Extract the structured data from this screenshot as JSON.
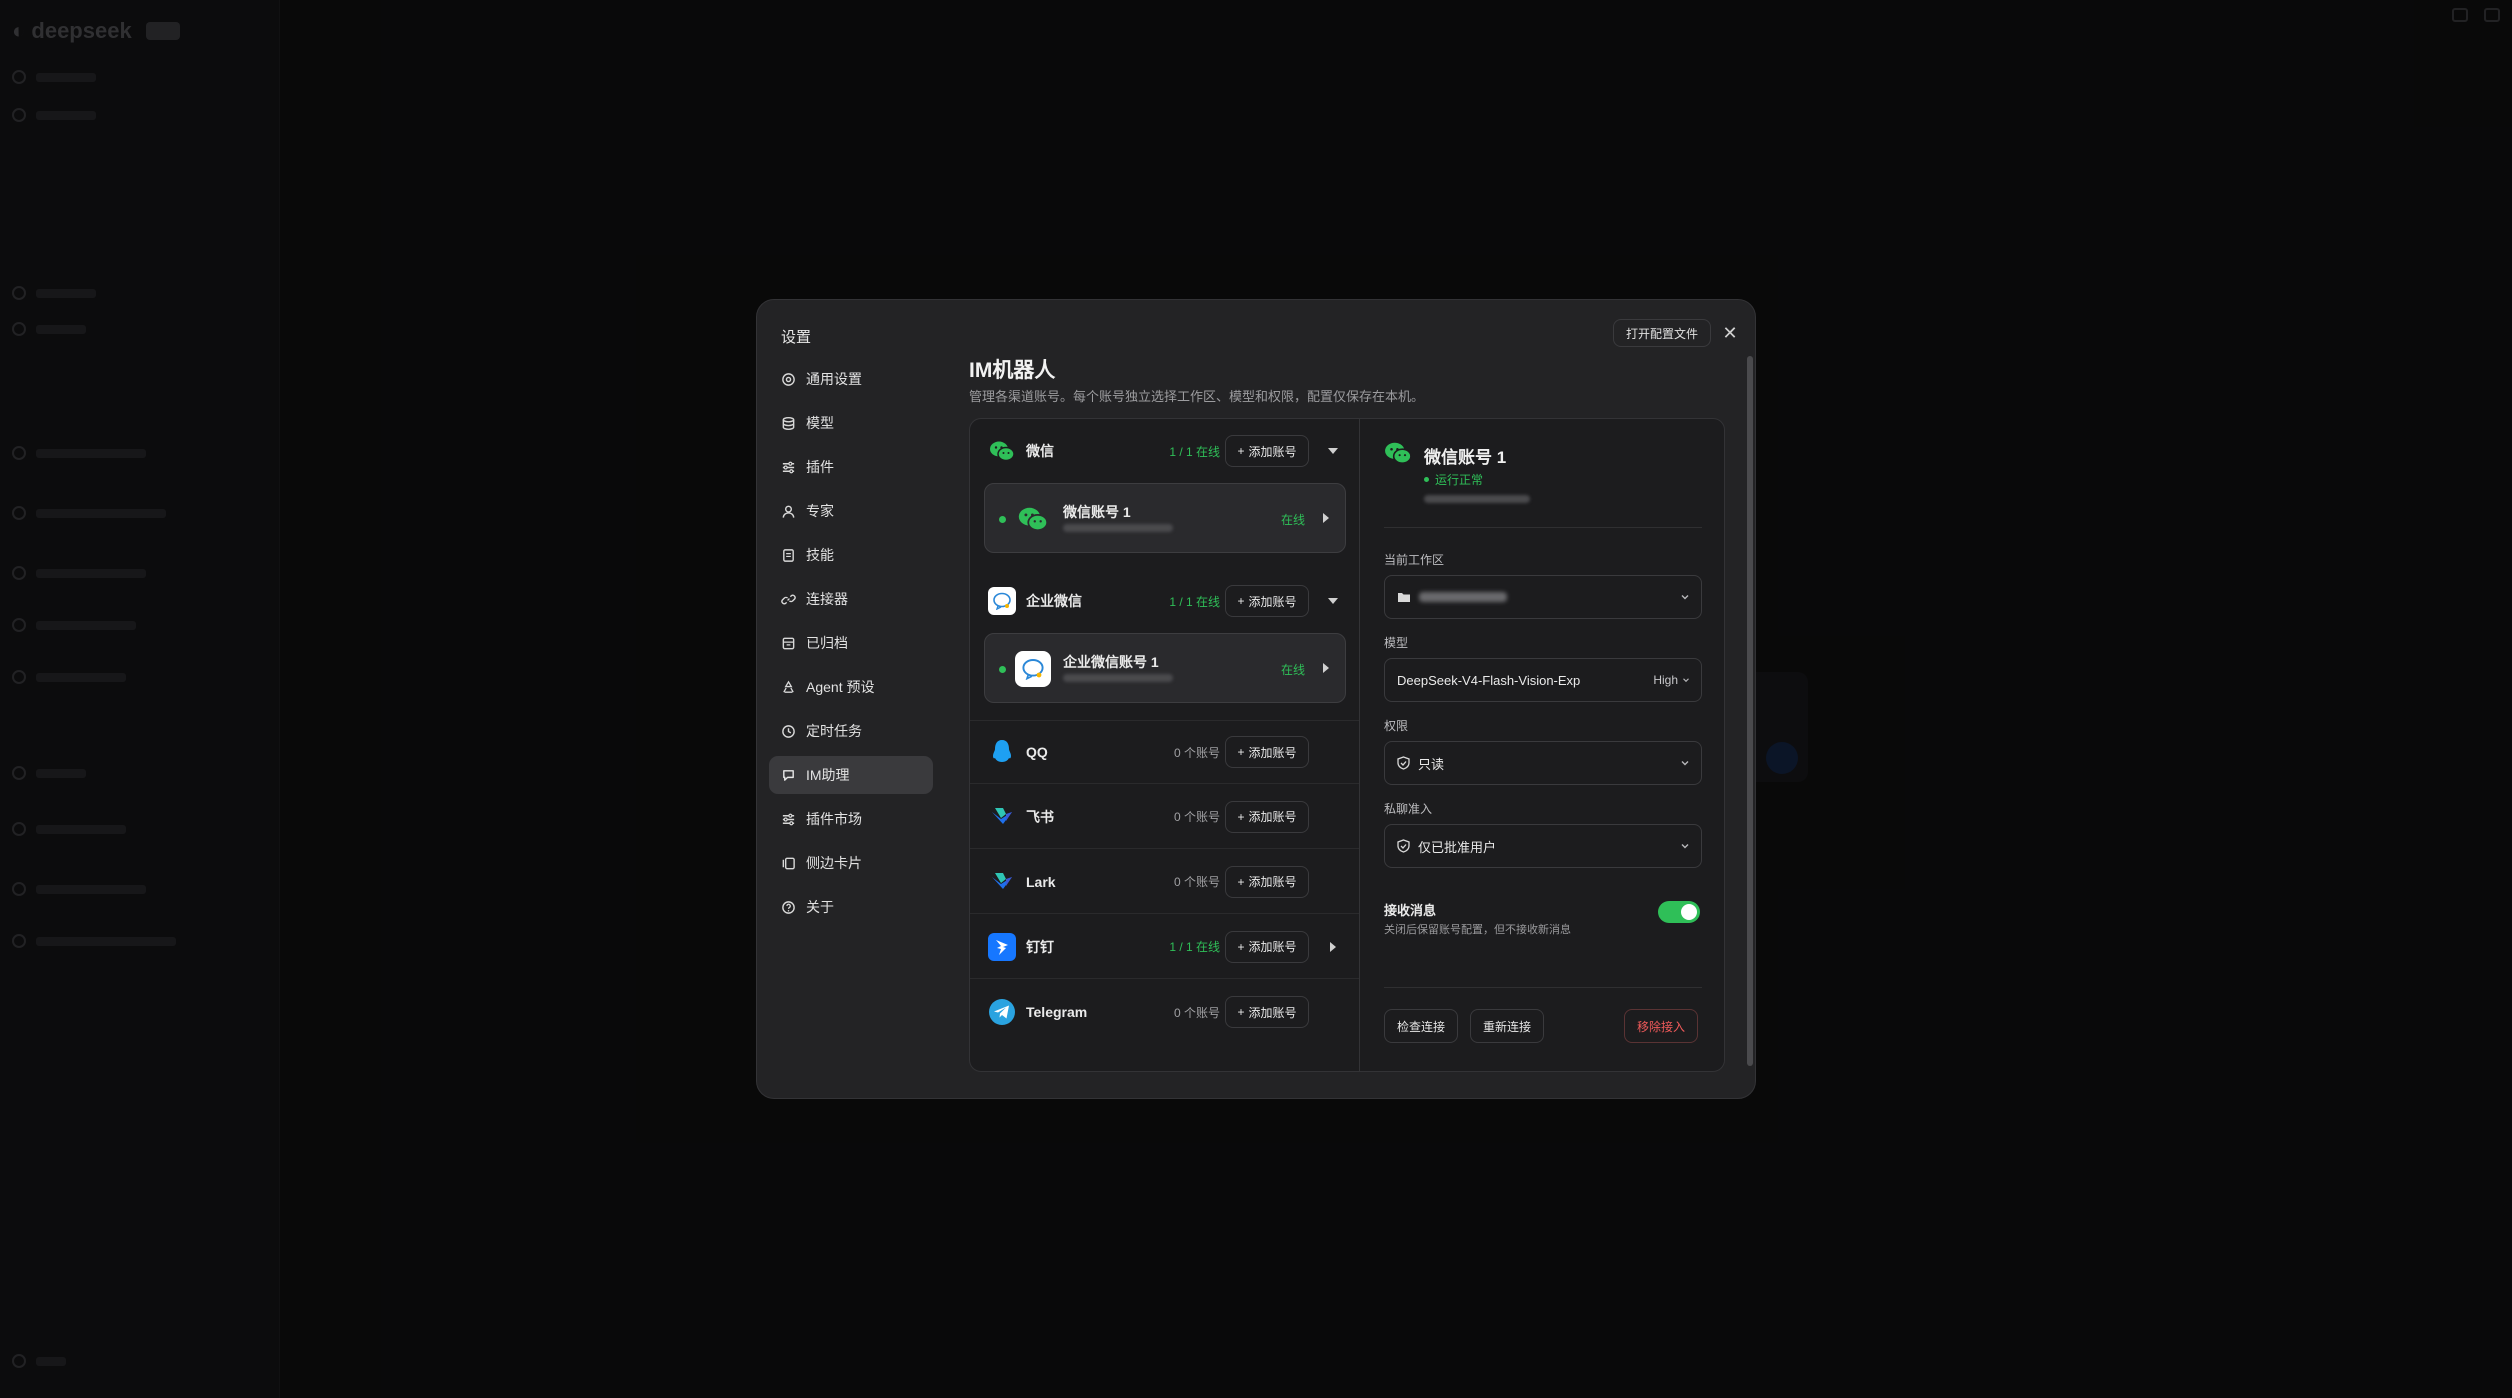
{
  "modal": {
    "title": "设置",
    "open_config_label": "打开配置文件",
    "close_label": "✕"
  },
  "nav": [
    {
      "label": "通用设置",
      "icon": "gear-icon",
      "active": false
    },
    {
      "label": "模型",
      "icon": "database-icon",
      "active": false
    },
    {
      "label": "插件",
      "icon": "sliders-icon",
      "active": false
    },
    {
      "label": "专家",
      "icon": "user-icon",
      "active": false
    },
    {
      "label": "技能",
      "icon": "document-icon",
      "active": false
    },
    {
      "label": "连接器",
      "icon": "link-icon",
      "active": false
    },
    {
      "label": "已归档",
      "icon": "archive-icon",
      "active": false
    },
    {
      "label": "Agent 预设",
      "icon": "recycle-icon",
      "active": false
    },
    {
      "label": "定时任务",
      "icon": "clock-icon",
      "active": false
    },
    {
      "label": "IM助理",
      "icon": "chat-icon",
      "active": true
    },
    {
      "label": "插件市场",
      "icon": "sliders-icon",
      "active": false
    },
    {
      "label": "侧边卡片",
      "icon": "card-icon",
      "active": false
    },
    {
      "label": "关于",
      "icon": "help-icon",
      "active": false
    }
  ],
  "section": {
    "title": "IM机器人",
    "description": "管理各渠道账号。每个账号独立选择工作区、模型和权限，配置仅保存在本机。"
  },
  "platforms": {
    "wechat": {
      "name": "微信",
      "count": "1 / 1 在线",
      "add_label": "添加账号",
      "icon": "wechat-icon"
    },
    "wecom": {
      "name": "企业微信",
      "count": "1 / 1 在线",
      "add_label": "添加账号",
      "icon": "wecom-icon"
    },
    "qq": {
      "name": "QQ",
      "count": "0 个账号",
      "add_label": "添加账号",
      "icon": "qq-icon"
    },
    "feishu": {
      "name": "飞书",
      "count": "0 个账号",
      "add_label": "添加账号",
      "icon": "feishu-icon"
    },
    "lark": {
      "name": "Lark",
      "count": "0 个账号",
      "add_label": "添加账号",
      "icon": "lark-icon"
    },
    "dingtalk": {
      "name": "钉钉",
      "count": "1 / 1 在线",
      "add_label": "添加账号",
      "icon": "dingtalk-icon"
    },
    "telegram": {
      "name": "Telegram",
      "count": "0 个账号",
      "add_label": "添加账号",
      "icon": "telegram-icon"
    }
  },
  "accounts": {
    "wechat_account": {
      "name": "微信账号 1",
      "status": "在线"
    },
    "wecom_account": {
      "name": "企业微信账号 1",
      "status": "在线"
    }
  },
  "detail": {
    "name": "微信账号 1",
    "status": "运行正常",
    "workspace_label": "当前工作区",
    "model_label": "模型",
    "model_value": "DeepSeek-V4-Flash-Vision-Exp",
    "model_effort": "High",
    "permission_label": "权限",
    "permission_value": "只读",
    "dm_label": "私聊准入",
    "dm_value": "仅已批准用户",
    "receive_title": "接收消息",
    "receive_desc": "关闭后保留账号配置，但不接收新消息",
    "receive_enabled": true,
    "check_label": "检查连接",
    "reconnect_label": "重新连接",
    "remove_label": "移除接入"
  },
  "colors": {
    "accent_green": "#2fbf58",
    "danger": "#f05a5a",
    "modal_bg": "#232325"
  }
}
